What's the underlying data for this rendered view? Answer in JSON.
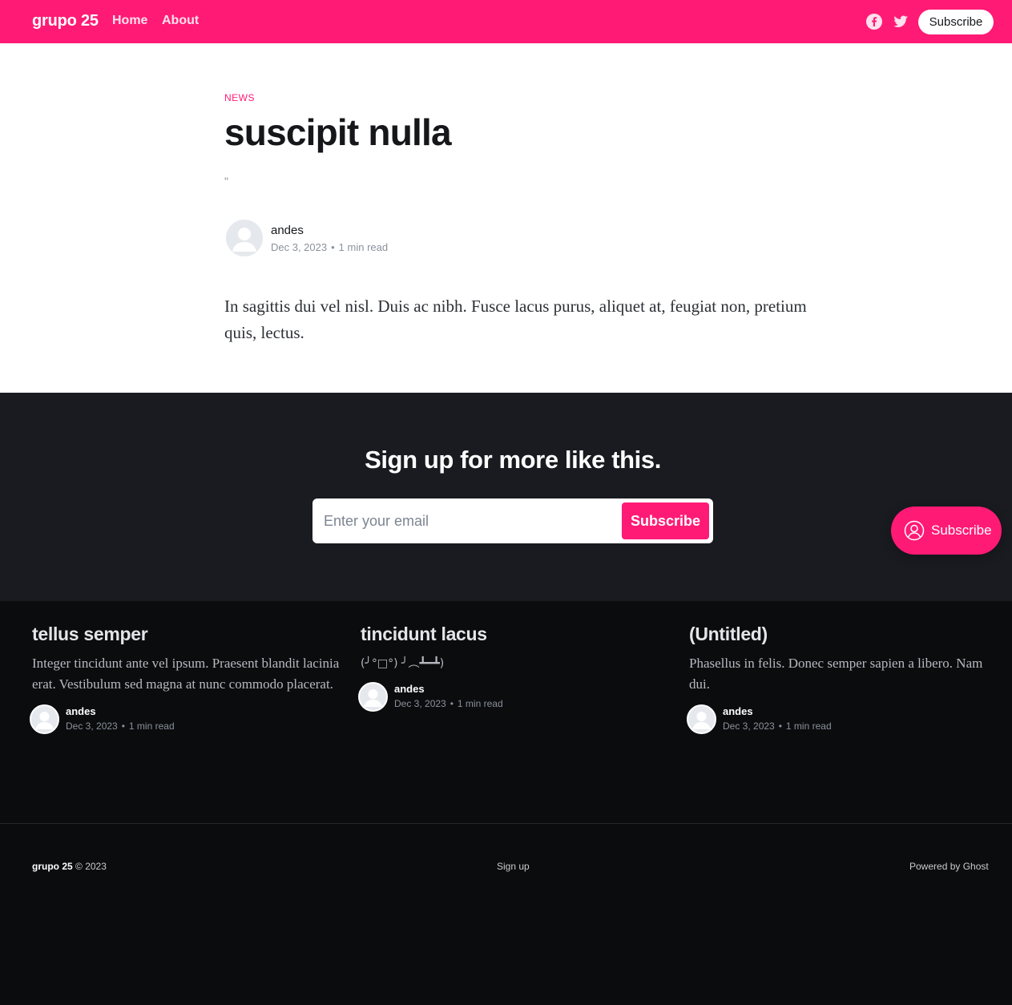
{
  "header": {
    "brand": "grupo 25",
    "nav": [
      {
        "label": "Home"
      },
      {
        "label": "About"
      }
    ],
    "social_icons": [
      "facebook-icon",
      "twitter-icon"
    ],
    "subscribe_label": "Subscribe",
    "accent_color": "#ff1a75"
  },
  "article": {
    "tag": "NEWS",
    "title": "suscipit nulla",
    "excerpt": "\"",
    "author": "andes",
    "date": "Dec 3, 2023",
    "reading_time": "1 min read",
    "body": "In sagittis dui vel nisl. Duis ac nibh. Fusce lacus purus, aliquet at, feugiat non, pretium quis, lectus."
  },
  "signup": {
    "title": "Sign up for more like this.",
    "email_placeholder": "Enter your email",
    "button_label": "Subscribe"
  },
  "portal": {
    "label": "Subscribe",
    "icon": "user-circle-icon"
  },
  "related_posts": [
    {
      "title": "tellus semper",
      "excerpt": "Integer tincidunt ante vel ipsum. Praesent blandit lacinia erat. Vestibulum sed magna at nunc commodo placerat.",
      "author": "andes",
      "date": "Dec 3, 2023",
      "reading_time": "1 min read"
    },
    {
      "title": "tincidunt lacus",
      "excerpt": "(╯°□°) ╯︵┻━┻)",
      "author": "andes",
      "date": "Dec 3, 2023",
      "reading_time": "1 min read"
    },
    {
      "title": "(Untitled)",
      "excerpt": "Phasellus in felis. Donec semper sapien a libero. Nam dui.",
      "author": "andes",
      "date": "Dec 3, 2023",
      "reading_time": "1 min read"
    }
  ],
  "footer": {
    "brand": "grupo 25",
    "copyright": "© 2023",
    "signup_link": "Sign up",
    "powered_by": "Powered by Ghost"
  }
}
